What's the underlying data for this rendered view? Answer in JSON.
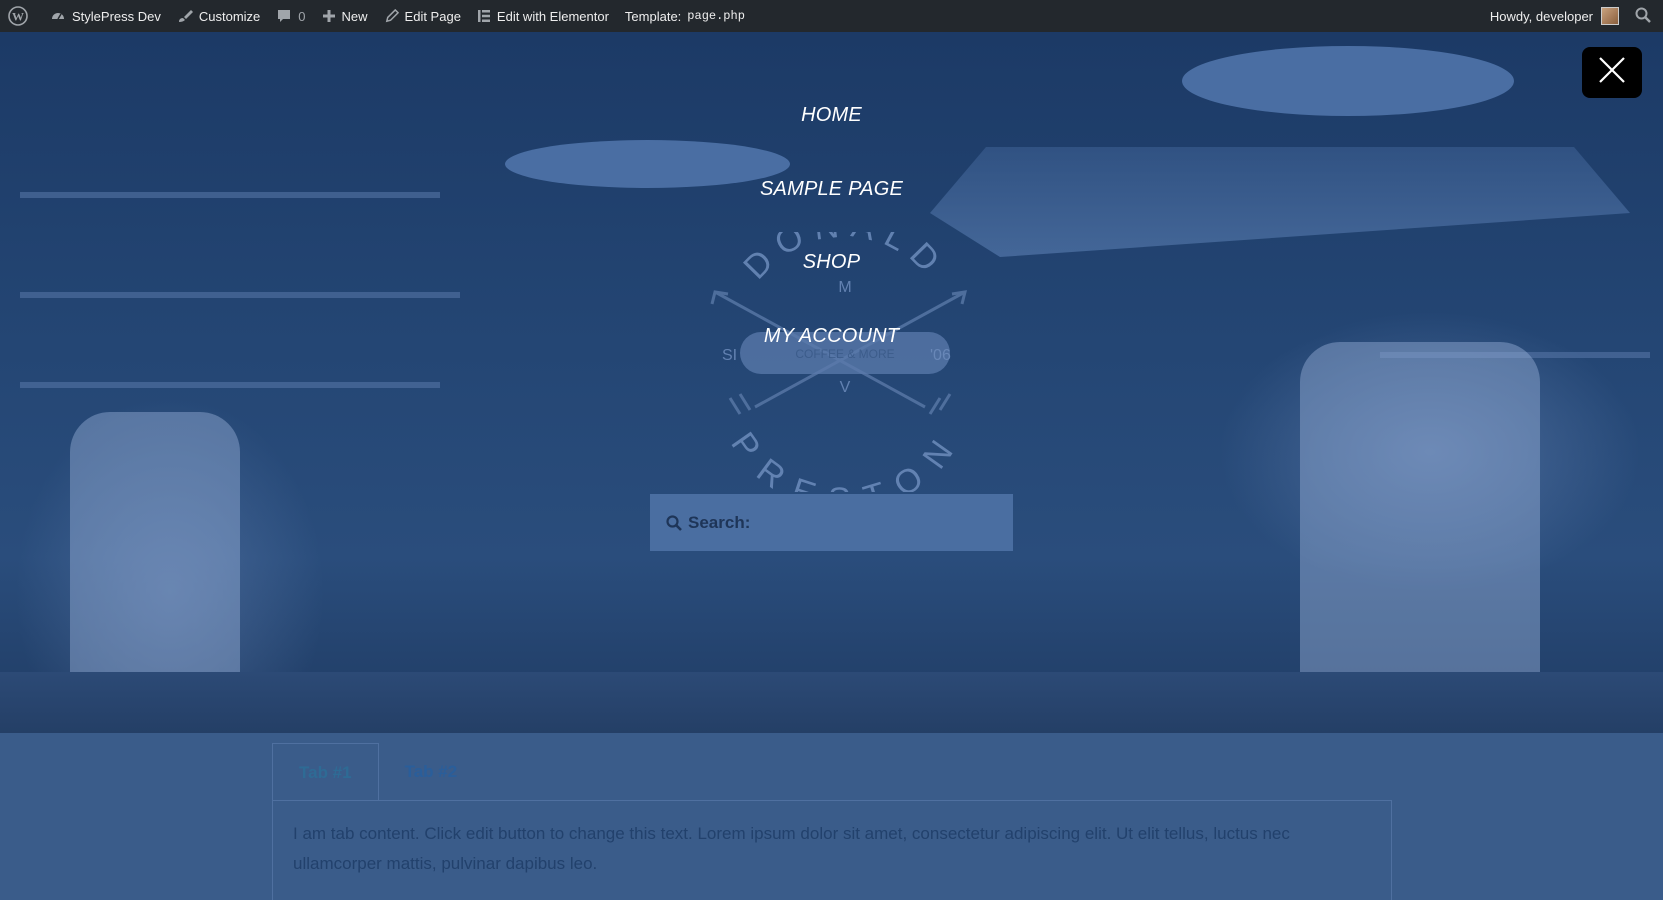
{
  "adminbar": {
    "items": [
      {
        "label": "",
        "icon": "wordpress-icon"
      },
      {
        "label": "StylePress Dev",
        "icon": "dashboard-icon"
      },
      {
        "label": "Customize",
        "icon": "brush-icon"
      },
      {
        "label": "0",
        "icon": "comment-icon"
      },
      {
        "label": "New",
        "icon": "plus-icon"
      },
      {
        "label": "Edit Page",
        "icon": "pencil-icon"
      },
      {
        "label": "Edit with Elementor",
        "icon": "elementor-icon"
      }
    ],
    "template_label": "Template:",
    "template_file": "page.php",
    "howdy": "Howdy, developer"
  },
  "menu": {
    "items": [
      "HOME",
      "SAMPLE PAGE",
      "SHOP",
      "MY ACCOUNT"
    ]
  },
  "logo": {
    "top_text": "DONALD",
    "bottom_text": "PRESTON",
    "middle": "COFFEE & MORE",
    "left": "SI",
    "right": "'06",
    "m": "M",
    "v": "V"
  },
  "search": {
    "placeholder": "Search:"
  },
  "tabs": {
    "items": [
      "Tab #1",
      "Tab #2"
    ],
    "active_index": 0,
    "content": "I am tab content. Click edit button to change this text. Lorem ipsum dolor sit amet, consectetur adipiscing elit. Ut elit tellus, luctus nec ullamcorper mattis, pulvinar dapibus leo."
  },
  "colors": {
    "overlay": "#1f3f6e",
    "adminbar": "#23282d",
    "close_button": "#000000"
  }
}
